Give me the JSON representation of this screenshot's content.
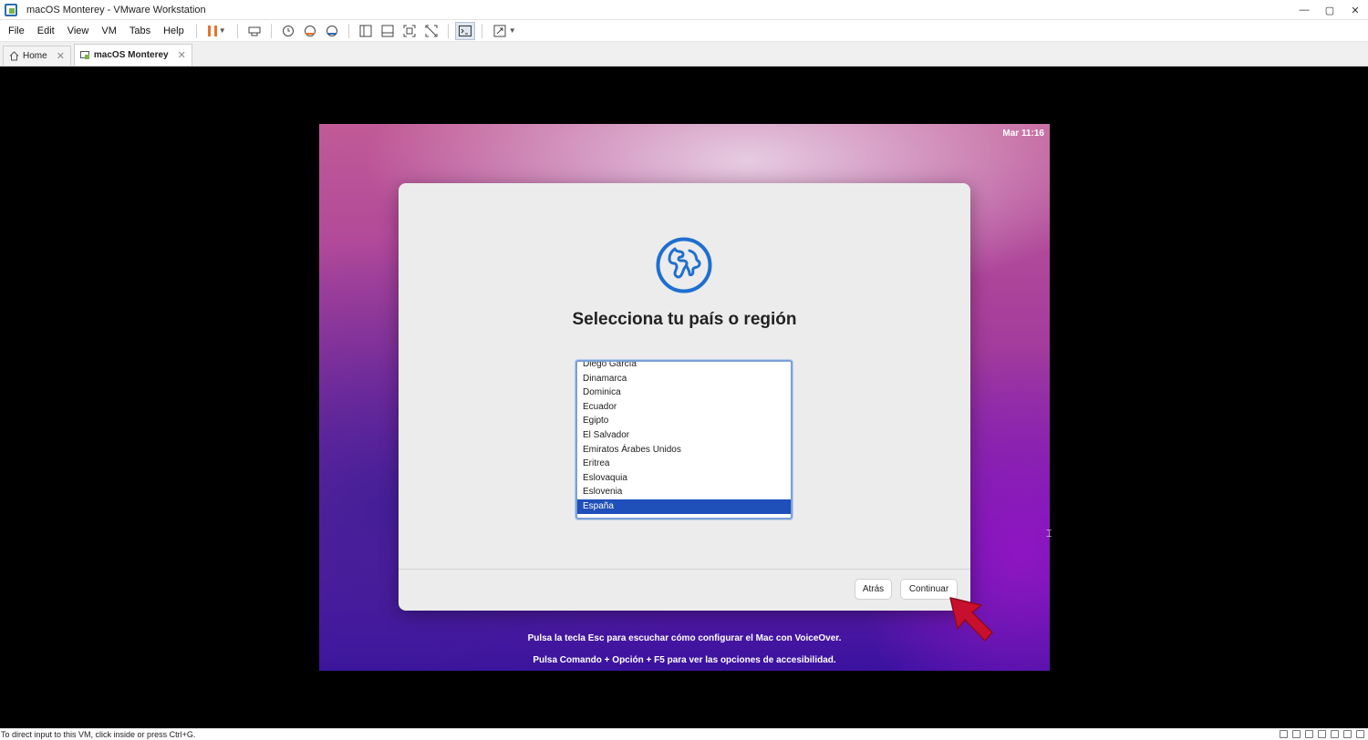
{
  "window": {
    "title": "macOS Monterey - VMware Workstation",
    "controls": [
      "—",
      "▢",
      "✕"
    ]
  },
  "menu": [
    "File",
    "Edit",
    "View",
    "VM",
    "Tabs",
    "Help"
  ],
  "tabs": [
    {
      "label": "Home",
      "icon": "home-icon",
      "active": false
    },
    {
      "label": "macOS Monterey",
      "icon": "vm-icon",
      "active": true
    }
  ],
  "vm": {
    "clock": "Mar 11:16",
    "dialog": {
      "title": "Selecciona tu país o región",
      "countries": [
        "Diego García",
        "Dinamarca",
        "Dominica",
        "Ecuador",
        "Egipto",
        "El Salvador",
        "Emiratos Árabes Unidos",
        "Eritrea",
        "Eslovaquia",
        "Eslovenia",
        "España"
      ],
      "selected": "España",
      "back_label": "Atrás",
      "continue_label": "Continuar"
    },
    "hint1": "Pulsa la tecla Esc para escuchar cómo configurar el Mac con VoiceOver.",
    "hint2": "Pulsa Comando + Opción + F5 para ver las opciones de accesibilidad."
  },
  "status": {
    "text": "To direct input to this VM, click inside or press Ctrl+G."
  },
  "colors": {
    "selection": "#1f4fb9",
    "globe": "#1f6fd0",
    "arrow": "#c8102e",
    "pause": "#e8742c"
  }
}
